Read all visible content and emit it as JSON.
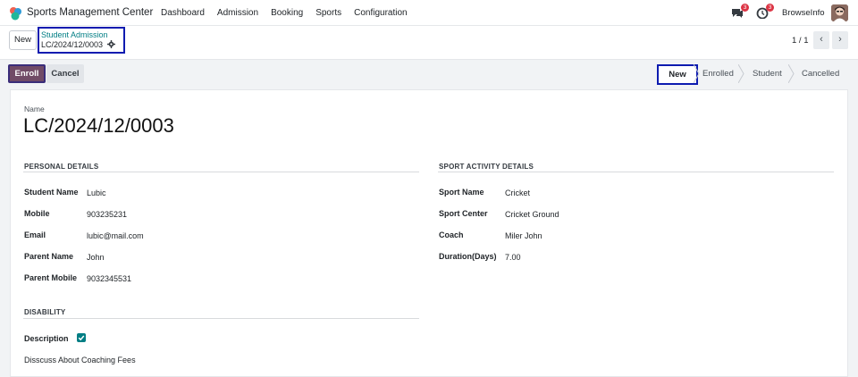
{
  "navbar": {
    "app_title": "Sports Management Center",
    "menu": [
      "Dashboard",
      "Admission",
      "Booking",
      "Sports",
      "Configuration"
    ],
    "messages_count": "3",
    "activities_count": "3",
    "company": "BrowseInfo"
  },
  "control": {
    "new_label": "New",
    "breadcrumb_parent": "Student Admission",
    "breadcrumb_current": "LC/2024/12/0003",
    "pager": "1 / 1"
  },
  "statusbar": {
    "enroll_label": "Enroll",
    "cancel_label": "Cancel",
    "stages": [
      "New",
      "Enrolled",
      "Student",
      "Cancelled"
    ],
    "active_stage": "New"
  },
  "form": {
    "name_label": "Name",
    "name_value": "LC/2024/12/0003",
    "personal": {
      "title": "PERSONAL DETAILS",
      "fields": [
        {
          "label": "Student Name",
          "value": "Lubic"
        },
        {
          "label": "Mobile",
          "value": "903235231"
        },
        {
          "label": "Email",
          "value": "lubic@mail.com"
        },
        {
          "label": "Parent Name",
          "value": "John"
        },
        {
          "label": "Parent Mobile",
          "value": "9032345531"
        }
      ]
    },
    "sport": {
      "title": "SPORT ACTIVITY DETAILS",
      "fields": [
        {
          "label": "Sport Name",
          "value": "Cricket"
        },
        {
          "label": "Sport Center",
          "value": "Cricket Ground"
        },
        {
          "label": "Coach",
          "value": "Miler John"
        },
        {
          "label": "Duration(Days)",
          "value": "7.00"
        }
      ]
    },
    "disability": {
      "title": "DISABILITY",
      "description_label": "Description",
      "description_checked": true,
      "note": "Disscuss About Coaching Fees"
    }
  },
  "colors": {
    "accent": "#714b67",
    "teal": "#017e84",
    "highlight_border": "#0d1bb0",
    "badge": "#dc3545"
  }
}
